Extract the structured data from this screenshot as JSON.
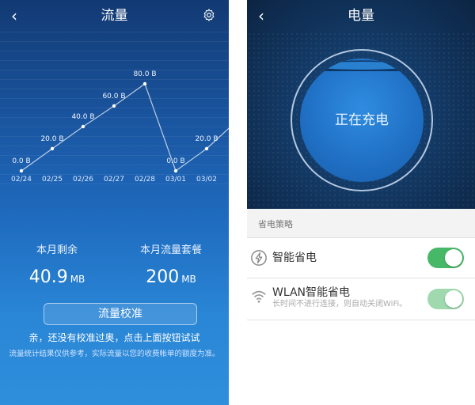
{
  "left": {
    "title": "流量",
    "back_icon": "chevron-left-icon",
    "settings_icon": "gear-icon",
    "remaining_label": "本月剩余",
    "remaining_value": "40.9",
    "remaining_unit": "MB",
    "plan_label": "本月流量套餐",
    "plan_value": "200",
    "plan_unit": "MB",
    "calibrate_button": "流量校准",
    "hint": "亲，还没有校准过奥，点击上面按钮试试",
    "disclaimer": "流量统计结果仅供参考，实际流量以您的收费帐单的额度为准。"
  },
  "chart_data": {
    "type": "line",
    "categories": [
      "02/24",
      "02/25",
      "02/26",
      "02/27",
      "02/28",
      "03/01",
      "03/02"
    ],
    "values": [
      0,
      10,
      20,
      30,
      40,
      0,
      10
    ],
    "point_labels": [
      "0.0 B",
      "",
      "20.0 B",
      "40.0 B",
      "60.0 B",
      "80.0 B",
      "0.0 B",
      "20.0 B"
    ],
    "note": "labels printed on chart"
  },
  "right": {
    "title": "电量",
    "back_icon": "chevron-left-icon",
    "status": "正在充电",
    "section_title": "省电策略",
    "items": [
      {
        "label": "智能省电",
        "sub": "",
        "icon": "power-save-icon",
        "on": true
      },
      {
        "label": "WLAN智能省电",
        "sub": "长时间不进行连接，则自动关闭WiFi。",
        "icon": "wifi-icon",
        "on": true
      }
    ]
  }
}
